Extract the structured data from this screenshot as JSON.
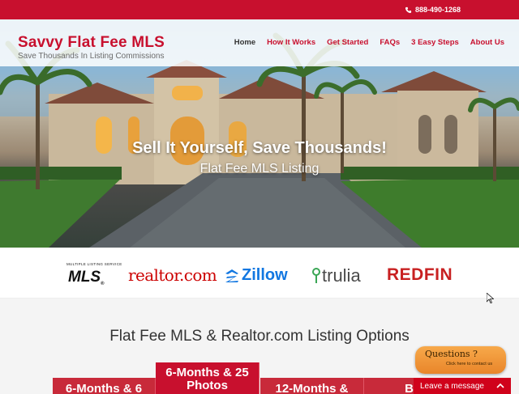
{
  "topbar": {
    "phone": "888-490-1268",
    "phone_icon": "phone-icon"
  },
  "brand": {
    "title": "Savvy Flat Fee MLS",
    "tagline": "Save Thousands In Listing Commissions"
  },
  "nav": {
    "items": [
      "Home",
      "How It Works",
      "Get Started",
      "FAQs",
      "3 Easy Steps",
      "About Us"
    ],
    "active": "Home"
  },
  "hero": {
    "headline": "Sell It Yourself, Save Thousands!",
    "subheadline": "Flat Fee MLS Listing"
  },
  "logos": {
    "mls_caption": "MULTIPLE LISTING SERVICE",
    "mls": "MLS",
    "mls_mark": "®",
    "realtor": "realtor.com",
    "zillow": "Zillow",
    "trulia": "trulia",
    "redfin": "REDFIN"
  },
  "options": {
    "title": "Flat Fee MLS & Realtor.com Listing Options",
    "tabs": [
      "6-Months & 6",
      "6-Months & 25 Photos",
      "12-Months &",
      "Bro"
    ]
  },
  "chat": {
    "question": "Questions ?",
    "question_sub": "Click here to contact us",
    "leave_message": "Leave a message"
  },
  "colors": {
    "brand_red": "#c8102e",
    "chat_orange": "#e9852a",
    "zillow_blue": "#1277e1"
  }
}
